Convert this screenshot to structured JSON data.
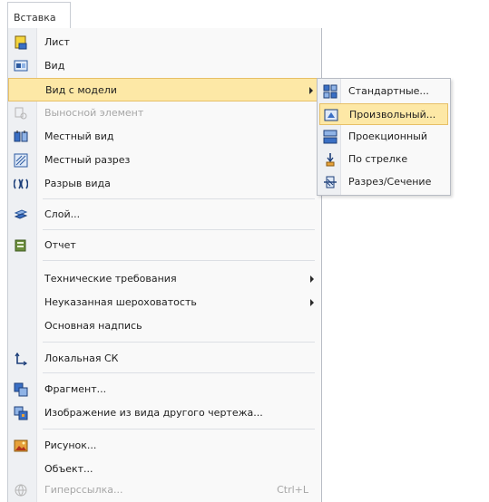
{
  "menubar": {
    "active_tab": "Вставка"
  },
  "menu": {
    "items": [
      {
        "label": "Лист",
        "icon": "sheet-icon"
      },
      {
        "label": "Вид",
        "icon": "view-icon"
      },
      {
        "label": "Вид с модели",
        "icon": "",
        "submenu": true,
        "highlighted": true
      },
      {
        "label": "Выносной элемент",
        "icon": "detail-element-icon",
        "disabled": true
      },
      {
        "label": "Местный вид",
        "icon": "local-view-icon"
      },
      {
        "label": "Местный разрез",
        "icon": "local-section-icon"
      },
      {
        "label": "Разрыв вида",
        "icon": "view-break-icon"
      },
      {
        "label": "Слой...",
        "icon": "layer-icon"
      },
      {
        "label": "Отчет",
        "icon": "report-icon"
      },
      {
        "label": "Технические требования",
        "submenu": true
      },
      {
        "label": "Неуказанная шероховатость",
        "submenu": true
      },
      {
        "label": "Основная надпись"
      },
      {
        "label": "Локальная СК",
        "icon": "local-cs-icon"
      },
      {
        "label": "Фрагмент...",
        "icon": "fragment-icon"
      },
      {
        "label": "Изображение из вида другого чертежа...",
        "icon": "image-from-view-icon"
      },
      {
        "label": "Рисунок...",
        "icon": "picture-icon"
      },
      {
        "label": "Объект..."
      },
      {
        "label": "Гиперссылка...",
        "icon": "hyperlink-icon",
        "disabled": true,
        "shortcut": "Ctrl+L"
      }
    ]
  },
  "submenu": {
    "items": [
      {
        "label": "Стандартные...",
        "icon": "standard-views-icon"
      },
      {
        "label": "Произвольный...",
        "icon": "arbitrary-view-icon",
        "highlighted": true
      },
      {
        "label": "Проекционный",
        "icon": "projection-view-icon"
      },
      {
        "label": "По стрелке",
        "icon": "arrow-view-icon"
      },
      {
        "label": "Разрез/Сечение",
        "icon": "section-view-icon"
      }
    ]
  },
  "colors": {
    "highlight": "#fde8a6",
    "highlight_border": "#e7c067",
    "menu_background": "#f9f9f9",
    "gutter": "#eef0f3",
    "disabled_text": "#a6a6a6"
  }
}
